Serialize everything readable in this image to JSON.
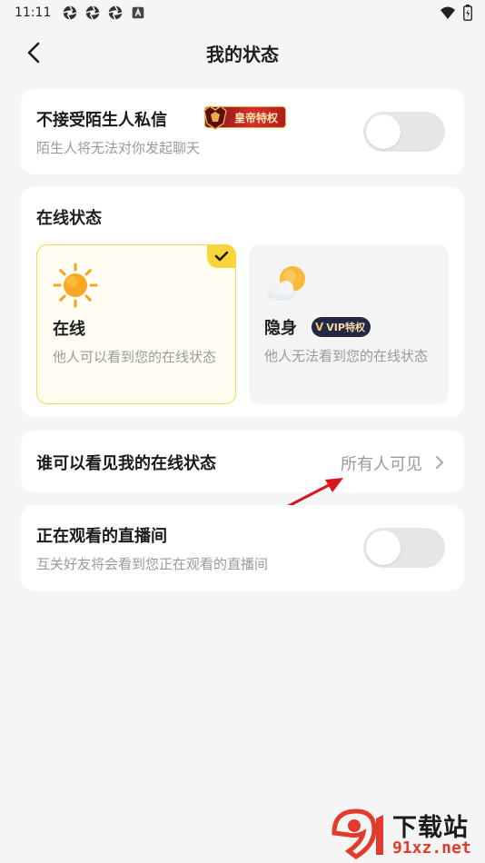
{
  "status_bar": {
    "time": "11:11"
  },
  "nav": {
    "title": "我的状态"
  },
  "stranger_dm": {
    "title": "不接受陌生人私信",
    "badge": "皇帝特权",
    "subtitle": "陌生人将无法对你发起聊天",
    "enabled": false
  },
  "online_status": {
    "title": "在线状态",
    "options": [
      {
        "label": "在线",
        "desc": "他人可以看到您的在线状态",
        "selected": true,
        "icon": "sun-icon"
      },
      {
        "label": "隐身",
        "badge": "VIP特权",
        "desc": "他人无法看到您的在线状态",
        "selected": false,
        "icon": "cloud-sun-icon"
      }
    ]
  },
  "visibility": {
    "title": "谁可以看见我的在线状态",
    "value": "所有人可见"
  },
  "watching": {
    "title": "正在观看的直播间",
    "subtitle": "互关好友将会看到您正在观看的直播间",
    "enabled": false
  },
  "watermark": {
    "top": "下载站",
    "bottom": "91xz.net"
  },
  "colors": {
    "accent_yellow": "#f8d63a",
    "arrow_red": "#d9141b",
    "text_gray": "#9a9a9a"
  }
}
